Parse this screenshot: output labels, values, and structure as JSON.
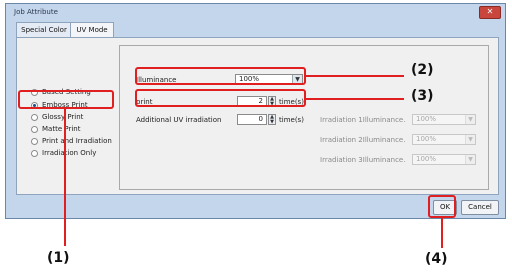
{
  "dialog": {
    "title": "Job Attribute",
    "close_glyph": "✕"
  },
  "tabs": [
    {
      "label": "Special Color"
    },
    {
      "label": "UV Mode"
    }
  ],
  "modes": [
    {
      "label": "Based Setting",
      "selected": false
    },
    {
      "label": "Emboss Print",
      "selected": true
    },
    {
      "label": "Glossy Print",
      "selected": false
    },
    {
      "label": "Matte Print",
      "selected": false
    },
    {
      "label": "Print and Irradiation",
      "selected": false
    },
    {
      "label": "Irradiation Only",
      "selected": false
    }
  ],
  "settings": {
    "illuminance_label": "Illuminance",
    "illuminance_value": "100%",
    "print_label": "print",
    "print_value": "2",
    "print_unit": "time(s)",
    "additional_label": "Additional UV irradiation",
    "additional_value": "0",
    "additional_unit": "time(s)"
  },
  "irradiation": [
    {
      "label": "Irradiation 1Illuminance.",
      "value": "100%"
    },
    {
      "label": "Irradiation 2Illuminance.",
      "value": "100%"
    },
    {
      "label": "Irradiation 3Illuminance.",
      "value": "100%"
    }
  ],
  "buttons": {
    "ok": "OK",
    "cancel": "Cancel"
  },
  "callouts": {
    "c1": "(1)",
    "c2": "(2)",
    "c3": "(3)",
    "c4": "(4)"
  },
  "colors": {
    "callout": "#e02020",
    "dialog_bg": "#c4d6ec"
  }
}
